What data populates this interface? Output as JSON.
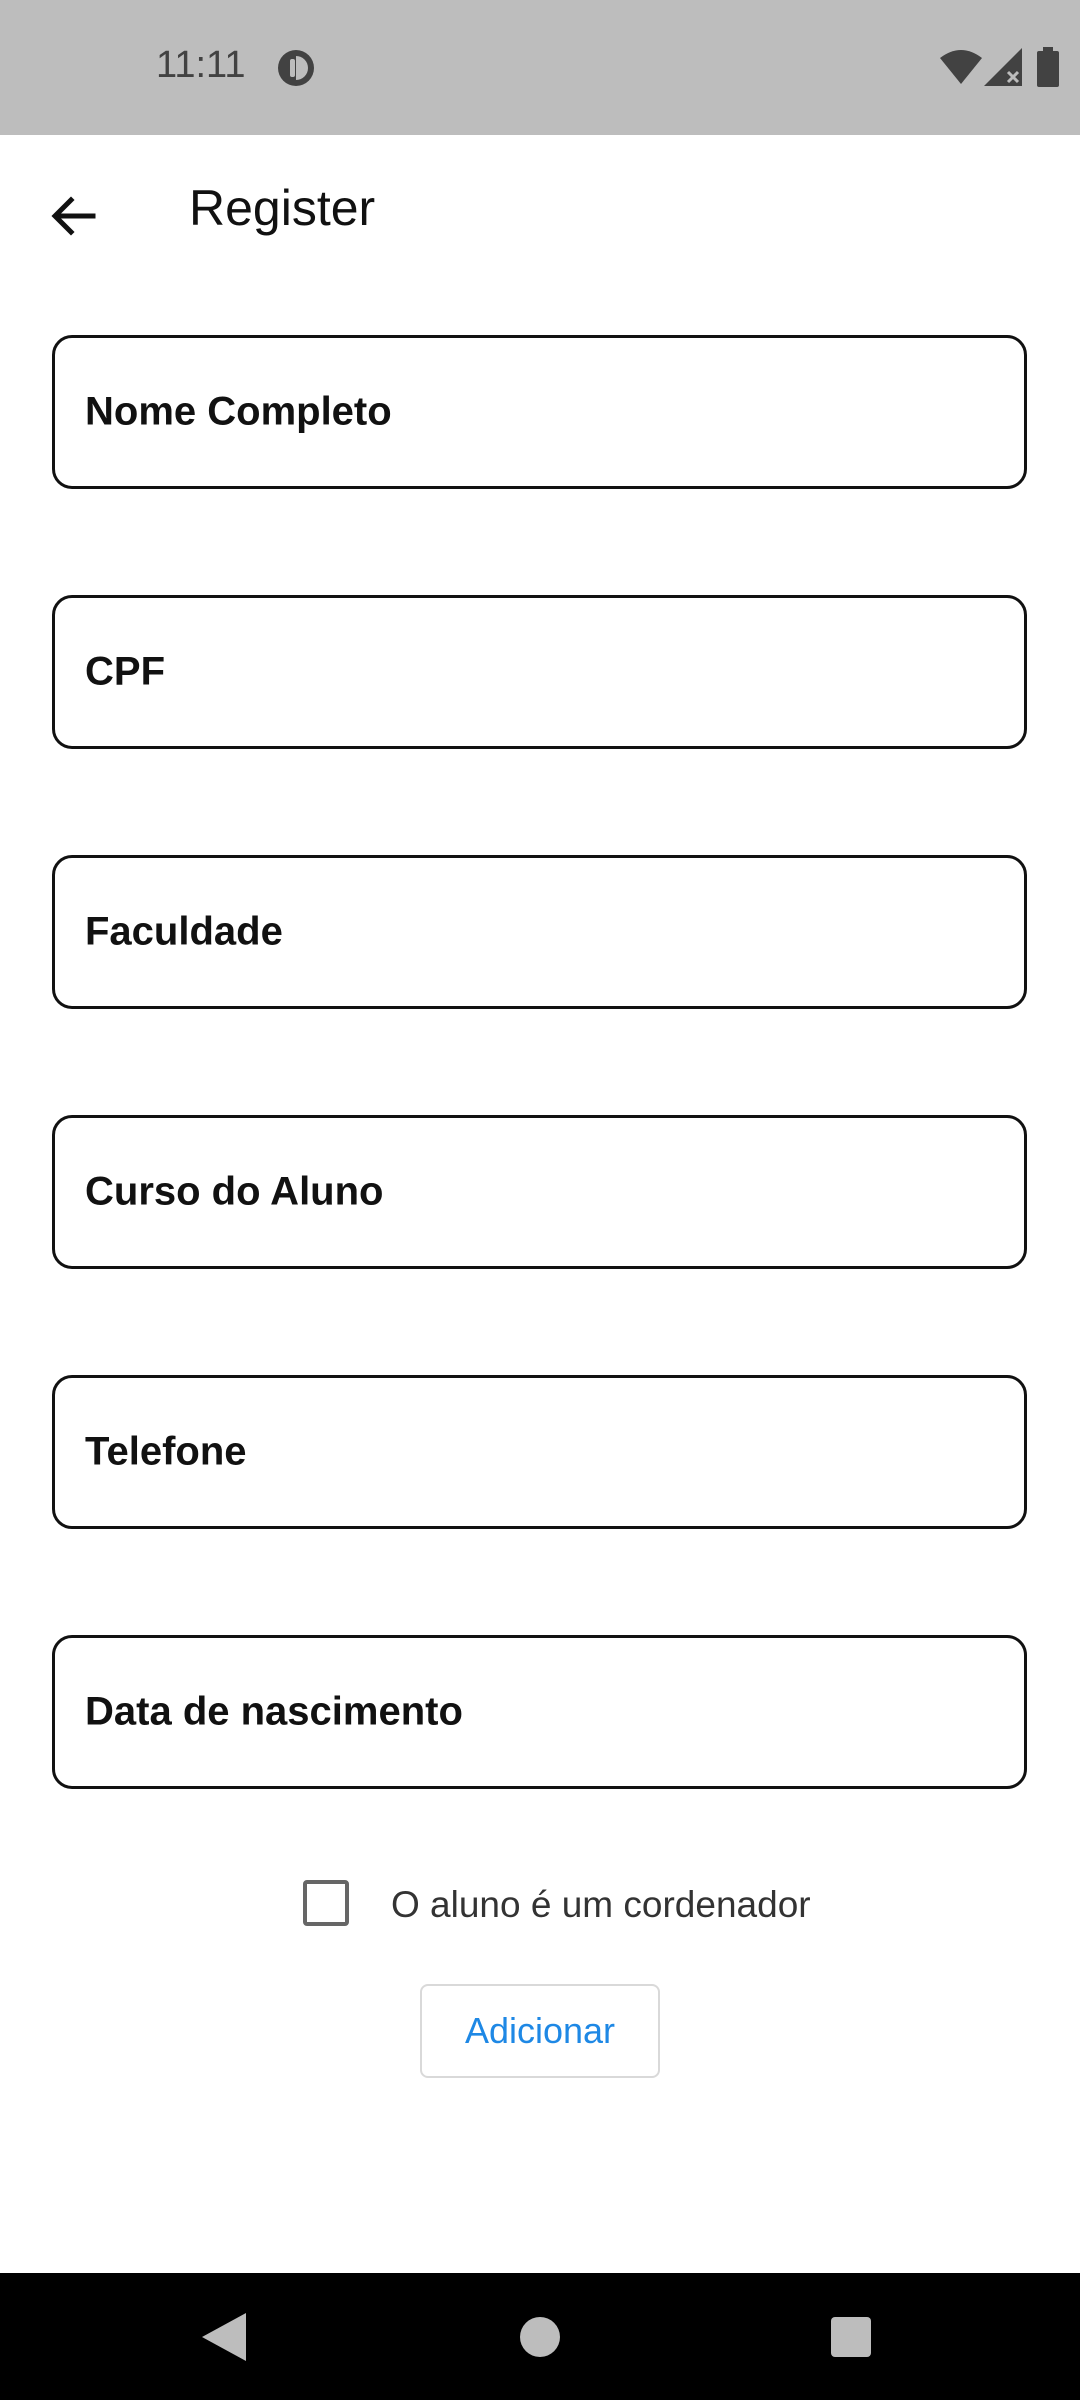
{
  "status_bar": {
    "time": "11:11",
    "icons": [
      "app-notification-icon",
      "wifi-icon",
      "signal-icon",
      "battery-icon"
    ]
  },
  "app_bar": {
    "title": "Register",
    "back_icon": "arrow-back-icon"
  },
  "form": {
    "fields": [
      {
        "label": "Nome Completo",
        "value": ""
      },
      {
        "label": "CPF",
        "value": ""
      },
      {
        "label": "Faculdade",
        "value": ""
      },
      {
        "label": "Curso do Aluno",
        "value": ""
      },
      {
        "label": "Telefone",
        "value": ""
      },
      {
        "label": "Data de nascimento",
        "value": ""
      }
    ],
    "coordinator_checkbox": {
      "label": "O aluno é um cordenador",
      "checked": false
    },
    "submit_label": "Adicionar"
  },
  "colors": {
    "status_bar": "#bdbdbd",
    "accent": "#1e88e5",
    "border": "#111111"
  },
  "nav_bar": {
    "icons": [
      "nav-back-icon",
      "nav-home-icon",
      "nav-recents-icon"
    ]
  }
}
